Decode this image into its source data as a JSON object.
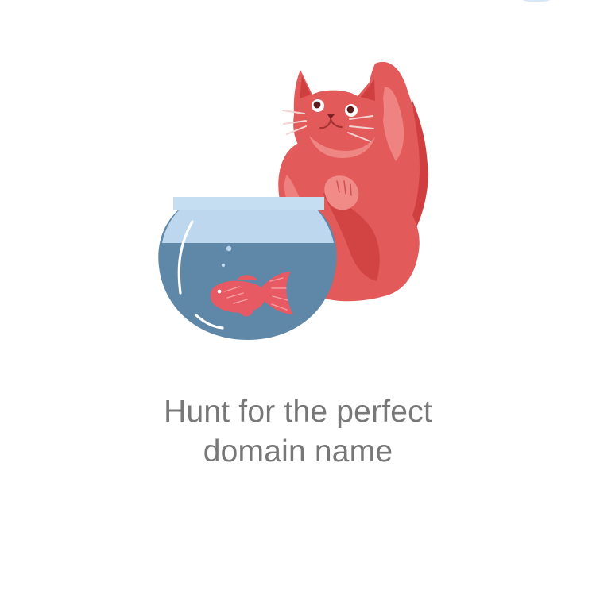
{
  "app": {
    "background": "#ffffff"
  },
  "hero": {
    "illustration": {
      "subject": "cat-looking-at-fishbowl",
      "icons": [
        "cat-icon",
        "fishbowl-icon",
        "goldfish-icon"
      ],
      "colors": {
        "cat": "#e25a5a",
        "cat_shadow": "#cf3f3f",
        "cat_highlight": "#f08b88",
        "bowl_rim": "#bcd7ee",
        "water": "#5e87a8",
        "fish": "#e85a63"
      }
    },
    "title_lines": [
      "Hunt for the perfect",
      "domain name"
    ],
    "title_color": "#777777"
  }
}
